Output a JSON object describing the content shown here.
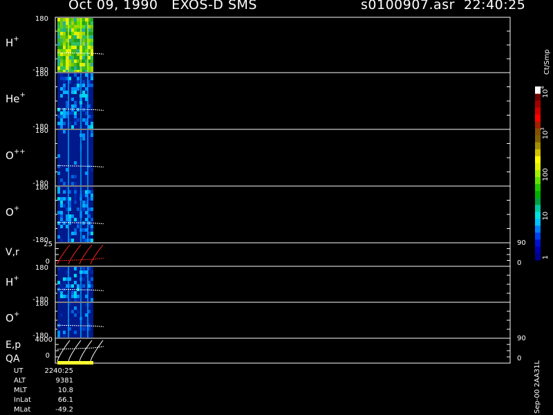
{
  "header": {
    "date_instrument": "Oct 09, 1990   EXOS-D SMS",
    "file_time": "s0100907.asr  22:40:25"
  },
  "footer": {
    "version": "Sep-00 2AA31L"
  },
  "info": [
    {
      "label": "UT",
      "value": "2240:25"
    },
    {
      "label": "ALT",
      "value": "9381"
    },
    {
      "label": "MLT",
      "value": "10.8"
    },
    {
      "label": "InLat",
      "value": "66.1"
    },
    {
      "label": "MLat",
      "value": "-49.2"
    }
  ],
  "colors": {
    "background": "#000000",
    "frame": "#ffffff",
    "spectrum_fill": "#001a8c",
    "velocity_trace": "#ff2020",
    "qa_bar": "#ffff30"
  },
  "chart_data": [
    {
      "type": "heatmap",
      "name": "H+",
      "ylabel_base": "H",
      "ylabel_sup": "+",
      "ylim": [
        -180,
        180
      ],
      "tick_top": "180",
      "tick_bottom": "-180",
      "level": "high"
    },
    {
      "type": "heatmap",
      "name": "He+",
      "ylabel_base": "He",
      "ylabel_sup": "+",
      "ylim": [
        -180,
        180
      ],
      "tick_top": "180",
      "tick_bottom": "-180",
      "level": "low"
    },
    {
      "type": "heatmap",
      "name": "O++",
      "ylabel_base": "O",
      "ylabel_sup": "++",
      "ylim": [
        -180,
        180
      ],
      "tick_top": "180",
      "tick_bottom": "-180",
      "level": "vlow"
    },
    {
      "type": "heatmap",
      "name": "O+",
      "ylabel_base": "O",
      "ylabel_sup": "+",
      "ylim": [
        -180,
        180
      ],
      "tick_top": "180",
      "tick_bottom": "-180",
      "tick_right": "",
      "level": "low"
    },
    {
      "type": "line",
      "name": "V,r",
      "ylabel": "V,r",
      "tick_top": "25",
      "tick_bottom": "0",
      "right_top": "90",
      "right_bottom": "0"
    },
    {
      "type": "heatmap",
      "name": "H+",
      "ylabel_base": "H",
      "ylabel_sup": "+",
      "ylim": [
        -180,
        180
      ],
      "tick_top": "180",
      "tick_bottom": "-180",
      "level": "low"
    },
    {
      "type": "heatmap",
      "name": "O+",
      "ylabel_base": "O",
      "ylabel_sup": "+",
      "ylim": [
        -180,
        180
      ],
      "tick_top": "180",
      "tick_bottom": "-180",
      "level": "vlow"
    },
    {
      "type": "line",
      "name": "E,p",
      "ylabel": "E,p",
      "ylabel2": "QA",
      "tick_top": "4000",
      "tick_bottom": "0",
      "right_top": "90",
      "right_bottom": "0"
    }
  ],
  "colorbar": {
    "unit_label": "Ct/Smp",
    "tick_labels": [
      {
        "text": "1",
        "value": 1
      },
      {
        "text": "10",
        "value": 10
      },
      {
        "text": "100",
        "value": 100
      },
      {
        "text": "10",
        "sup": "3",
        "value": 1000
      },
      {
        "text": "10",
        "sup": "4",
        "value": 10000
      }
    ],
    "colors": [
      "#000090",
      "#0000b0",
      "#0010d0",
      "#0040f0",
      "#0080ff",
      "#00c0ff",
      "#00e0e0",
      "#00c8a0",
      "#00a040",
      "#00b000",
      "#20c800",
      "#60e000",
      "#a0f000",
      "#e0f000",
      "#ffff00",
      "#d0c000",
      "#a09000",
      "#806000",
      "#805000",
      "#a02000",
      "#ff0000",
      "#d00000",
      "#a00000",
      "#700000",
      "#ffffff"
    ]
  }
}
